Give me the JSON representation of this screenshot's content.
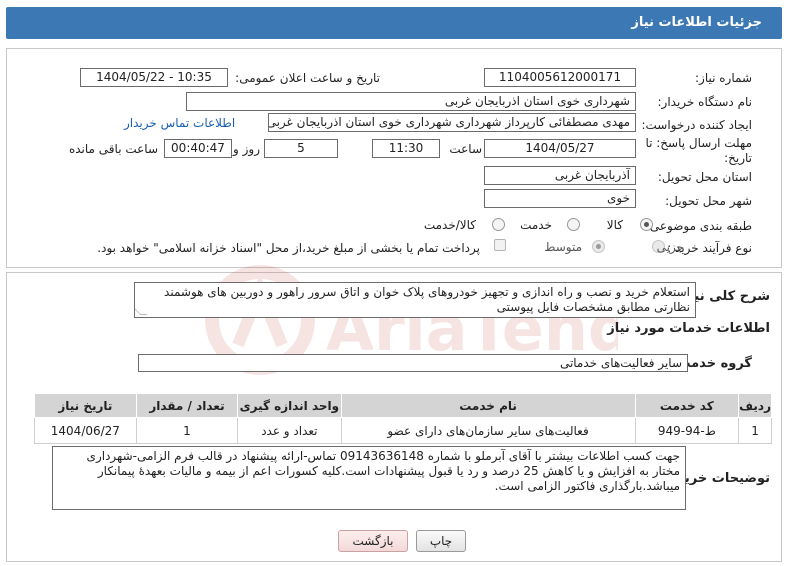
{
  "page": {
    "title": "جزئیات اطلاعات نیاز"
  },
  "need": {
    "number_label": "شماره نیاز:",
    "number_value": "1104005612000171",
    "announce_label": "تاریخ و ساعت اعلان عمومی:",
    "announce_value": "1404/05/22 - 10:35",
    "buyer_label": "نام دستگاه خریدار:",
    "buyer_value": "شهرداری خوی استان اذربایجان غربی",
    "creator_label": "ایجاد کننده درخواست:",
    "creator_value": "مهدی مصطفائی کارپرداز شهرداری شهرداری خوی استان اذربایجان غربی",
    "contact_link": "اطلاعات تماس خریدار",
    "deadline_label_1": "مهلت ارسال پاسخ: تا",
    "deadline_label_2": "تاریخ:",
    "deadline_date": "1404/05/27",
    "time_label": "ساعت",
    "deadline_time": "11:30",
    "days_value": "5",
    "days_label": "روز و",
    "remaining_value": "00:40:47",
    "remaining_label": "ساعت باقی مانده",
    "province_label": "استان محل تحویل:",
    "province_value": "آذربایجان غربی",
    "city_label": "شهر محل تحویل:",
    "city_value": "خوی",
    "category_label": "طبقه بندی موضوعی:",
    "category_options": [
      "کالا",
      "خدمت",
      "کالا/خدمت"
    ],
    "process_label": "نوع فرآیند خرید :",
    "process_options": [
      "جزیی",
      "متوسط"
    ],
    "payment_note": "پرداخت تمام یا بخشی از مبلغ خرید،از محل \"اسناد خزانه اسلامی\" خواهد بود."
  },
  "summary": {
    "label": "شرح کلی نیاز:",
    "text": "استعلام خرید و نصب و راه اندازی و تجهیز خودروهای پلاک خوان و اتاق سرور راهور و دوربین های هوشمند نظارتی مطابق مشخصات فایل پیوستی"
  },
  "services": {
    "section_title": "اطلاعات خدمات مورد نیاز",
    "group_label": "گروه خدمت:",
    "group_value": "سایر فعالیت‌های خدماتی",
    "columns": [
      "ردیف",
      "کد خدمت",
      "نام خدمت",
      "واحد اندازه گیری",
      "تعداد / مقدار",
      "تاریخ نیاز"
    ],
    "rows": [
      [
        "1",
        "ط-94-949",
        "فعالیت‌های سایر سازمان‌های دارای عضو",
        "تعداد و عدد",
        "1",
        "1404/06/27"
      ]
    ]
  },
  "notes": {
    "label": "توضیحات خریدار:",
    "text": "جهت کسب اطلاعات بیشتر با آقای آبرملو با شماره 09143636148 تماس-ارائه پیشنهاد در قالب فرم الزامی-شهرداری مختار به افزایش و یا کاهش 25 درصد و رد یا قبول پیشنهادات است.کلیه کسورات اعم از بیمه و مالیات بعهدهٔ پیمانکار میباشد.بارگذاری فاکتور الزامی است."
  },
  "buttons": {
    "print": "چاپ",
    "back": "بازگشت"
  },
  "watermark": {
    "text": "AriaTender.neT"
  },
  "colors": {
    "header": "#3c79b4",
    "link": "#1a5fb4",
    "watermark": "#c0392b"
  }
}
